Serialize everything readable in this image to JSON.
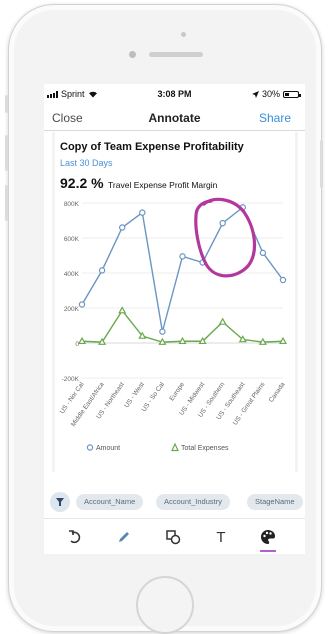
{
  "status_bar": {
    "carrier": "Sprint",
    "time": "3:08 PM",
    "battery": "30%",
    "battery_level": 0.3
  },
  "nav": {
    "close_label": "Close",
    "title": "Annotate",
    "share_label": "Share"
  },
  "card": {
    "title": "Copy of Team Expense Profitability",
    "period": "Last 30 Days",
    "kpi_value": "92.2 %",
    "kpi_label": "Travel Expense Profit Margin"
  },
  "chart_data": {
    "type": "line",
    "categories": [
      "US - Nor Cal",
      "Middle East/Africa",
      "US - Northeast",
      "US - West",
      "US - So Cal",
      "Europe",
      "US - Midwest",
      "US - Southern",
      "US - Southeast",
      "US - Great Plains",
      "Canada"
    ],
    "series": [
      {
        "name": "Amount",
        "color": "#6b95c4",
        "marker": "circle",
        "values": [
          220000,
          415000,
          660000,
          745000,
          65000,
          495000,
          460000,
          685000,
          775000,
          515000,
          360000
        ]
      },
      {
        "name": "Total Expenses",
        "color": "#6aa84f",
        "marker": "triangle",
        "values": [
          10000,
          5000,
          185000,
          40000,
          5000,
          10000,
          10000,
          120000,
          20000,
          5000,
          10000
        ]
      }
    ],
    "ylim": [
      -200000,
      800000
    ],
    "ytick_labels": [
      "800K",
      "600K",
      "400K",
      "200K",
      "0",
      "-200K"
    ],
    "ytick_values": [
      800000,
      600000,
      400000,
      200000,
      0,
      -200000
    ],
    "legend_position": "bottom",
    "grid": true
  },
  "annotation": {
    "shape": "freehand-circle",
    "color": "#b3389e"
  },
  "filters": {
    "chips": [
      "Account_Name",
      "Account_Industry",
      "StageName"
    ]
  },
  "toolbar": {
    "tools": [
      "undo-icon",
      "pen-icon",
      "shapes-icon",
      "text-icon",
      "palette-icon"
    ],
    "text_tool_label": "T",
    "active_tool": "palette-icon",
    "accent": "#b15fd1"
  }
}
